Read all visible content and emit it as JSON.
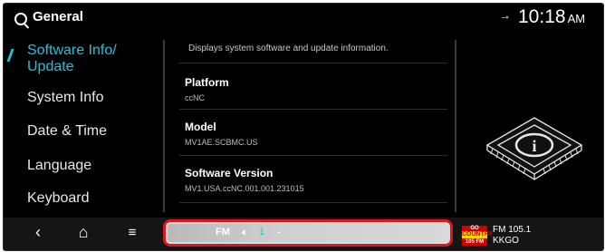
{
  "header": {
    "title": "General",
    "status_icon": "signal-off-icon",
    "time": "10:18",
    "ampm": "AM"
  },
  "sidebar": {
    "items": [
      {
        "label_line1": "Software Info/",
        "label_line2": "Update",
        "active": true
      },
      {
        "label": "System Info"
      },
      {
        "label": "Date & Time"
      },
      {
        "label": "Language"
      },
      {
        "label": "Keyboard"
      }
    ]
  },
  "content": {
    "description": "Displays system software and update information.",
    "rows": [
      {
        "label": "Platform",
        "value": "ccNC"
      },
      {
        "label": "Model",
        "value": "MV1AE.SCBMC.US"
      },
      {
        "label": "Software Version",
        "value": "MV1.USA.ccNC.001.001.231015"
      }
    ]
  },
  "bottom_nav": {
    "back_icon": "back-icon",
    "home_icon": "home-icon",
    "menu_icon": "menu-icon"
  },
  "media": {
    "source": "FM",
    "volume_icon": "speaker-icon",
    "volume": "1",
    "highlight_color": "#e0141b"
  },
  "radio": {
    "logo_top": "GO",
    "logo_mid": "COUNTRY",
    "logo_bottom": "105 FM",
    "frequency": "FM 105.1",
    "station": "KKGO"
  },
  "colors": {
    "accent": "#23c1dc",
    "background": "#000000"
  }
}
